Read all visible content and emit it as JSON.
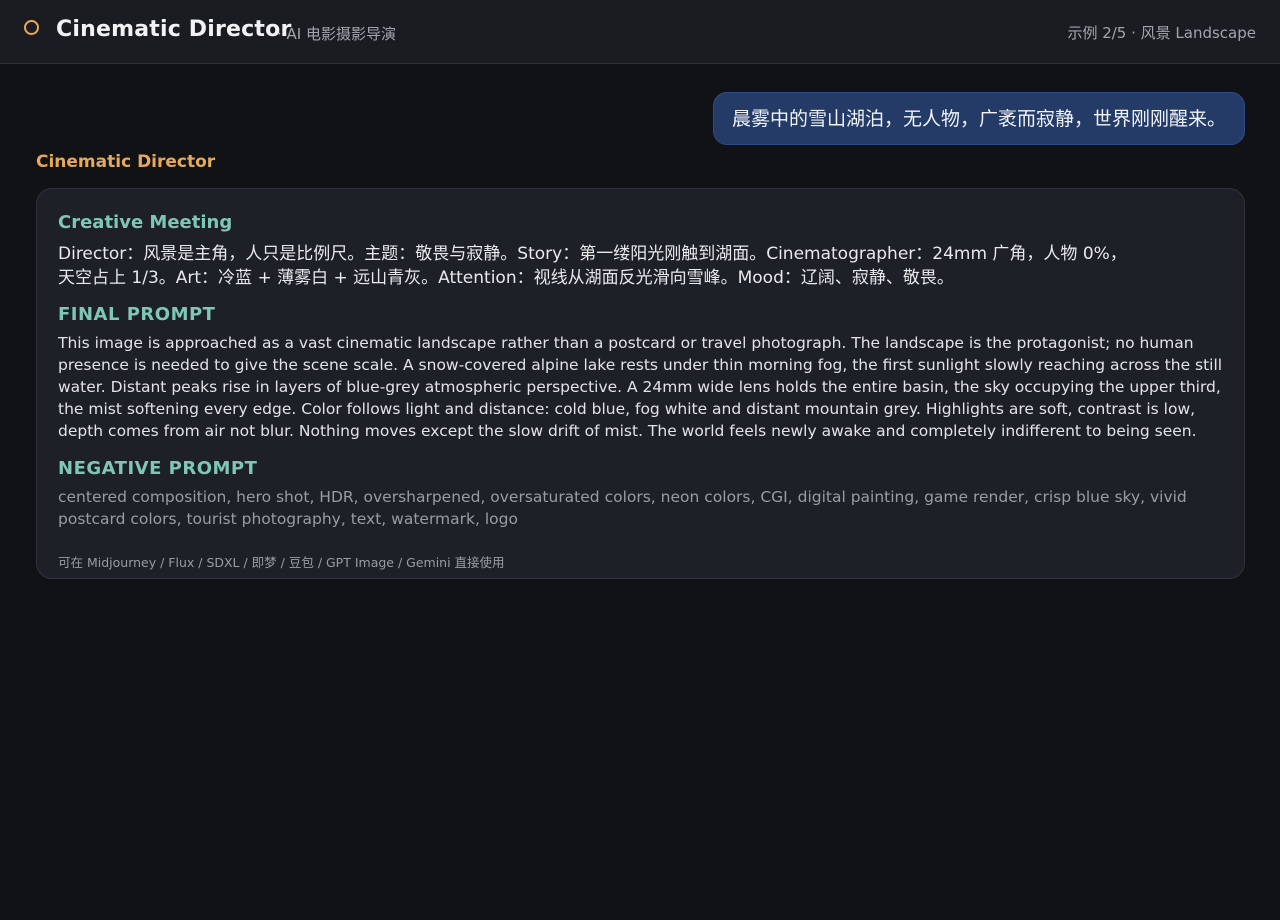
{
  "header": {
    "title": "Cinematic Director",
    "subtitle": "· AI 电影摄影导演",
    "example_indicator": "示例 2/5 · 风景 Landscape",
    "logo_icon": "circle-ring-icon",
    "accent_color": "#e5a95b"
  },
  "chat": {
    "user_message": "晨雾中的雪山湖泊，无人物，广袤而寂静，世界刚刚醒来。",
    "assistant_name": "Cinematic Director",
    "response": {
      "meeting_title": "Creative Meeting",
      "meeting_text": "Director：风景是主角，人只是比例尺。主题：敬畏与寂静。Story：第一缕阳光刚触到湖面。Cinematographer：24mm 广角，人物 0%，天空占上 1/3。Art：冷蓝 + 薄雾白 + 远山青灰。Attention：视线从湖面反光滑向雪峰。Mood：辽阔、寂静、敬畏。",
      "final_title": "FINAL PROMPT",
      "final_text": "This image is approached as a vast cinematic landscape rather than a postcard or travel photograph. The landscape is the protagonist; no human presence is needed to give the scene scale. A snow-covered alpine lake rests under thin morning fog, the first sunlight slowly reaching across the still water. Distant peaks rise in layers of blue-grey atmospheric perspective. A 24mm wide lens holds the entire basin, the sky occupying the upper third, the mist softening every edge. Color follows light and distance: cold blue, fog white and distant mountain grey. Highlights are soft, contrast is low, depth comes from air not blur. Nothing moves except the slow drift of mist. The world feels newly awake and completely indifferent to being seen.",
      "negative_title": "NEGATIVE PROMPT",
      "negative_text": "centered composition, hero shot, HDR, oversharpened, oversaturated colors, neon colors, CGI, digital painting, game render, crisp blue sky, vivid postcard colors, tourist photography, text, watermark, logo",
      "usage_note": "可在 Midjourney / Flux / SDXL / 即梦 / 豆包 / GPT Image / Gemini 直接使用"
    }
  }
}
